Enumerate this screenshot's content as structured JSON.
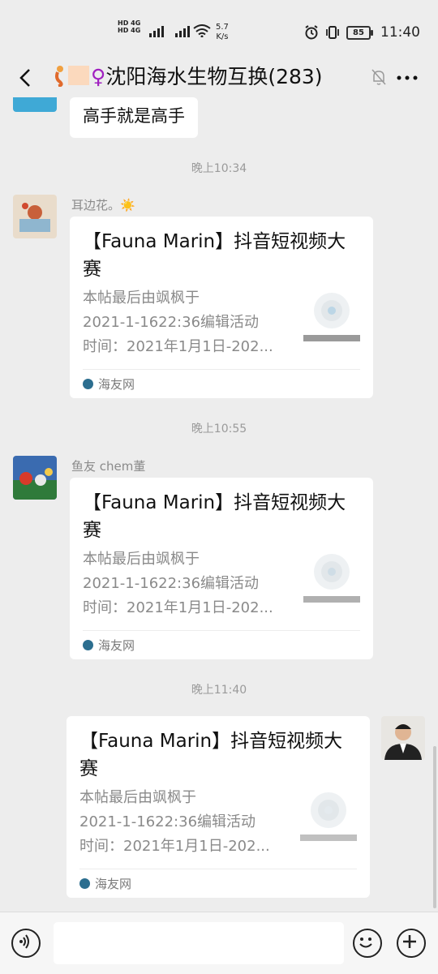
{
  "status_bar": {
    "net_top": "HD 4G",
    "net_bottom": "HD 4G",
    "speed_value": "5.7",
    "speed_unit": "K/s",
    "battery": "85",
    "time": "11:40"
  },
  "header": {
    "title": "沈阳海水生物互换(283)",
    "back_icon": "back-chevron-icon",
    "mute_icon": "muted-bell-icon",
    "more_icon": "more-dots-icon"
  },
  "messages": {
    "prev_text": "高手就是高手",
    "t1": "晚上10:34",
    "sender1": "耳边花。☀️",
    "t2": "晚上10:55",
    "sender2": "鱼友 chem董",
    "t3": "晚上11:40"
  },
  "cards": [
    {
      "title": "【Fauna Marin】抖音短视频大赛",
      "desc_line1": "本帖最后由飒枫于",
      "desc_line2": "2021-1-1622:36编辑活动",
      "desc_line3": "时间：2021年1月1日-202...",
      "source": "海友网"
    },
    {
      "title": "【Fauna Marin】抖音短视频大赛",
      "desc_line1": "本帖最后由飒枫于",
      "desc_line2": "2021-1-1622:36编辑活动",
      "desc_line3": "时间：2021年1月1日-202...",
      "source": "海友网"
    },
    {
      "title": "【Fauna Marin】抖音短视频大赛",
      "desc_line1": "本帖最后由飒枫于",
      "desc_line2": "2021-1-1622:36编辑活动",
      "desc_line3": "时间：2021年1月1日-202...",
      "source": "海友网"
    }
  ],
  "input_bar": {
    "voice_icon": "voice-icon",
    "emoji_icon": "emoji-icon",
    "plus_icon": "plus-icon"
  },
  "colors": {
    "background": "#ededed",
    "bubble": "#ffffff",
    "meta_text": "#9a9a9a"
  }
}
